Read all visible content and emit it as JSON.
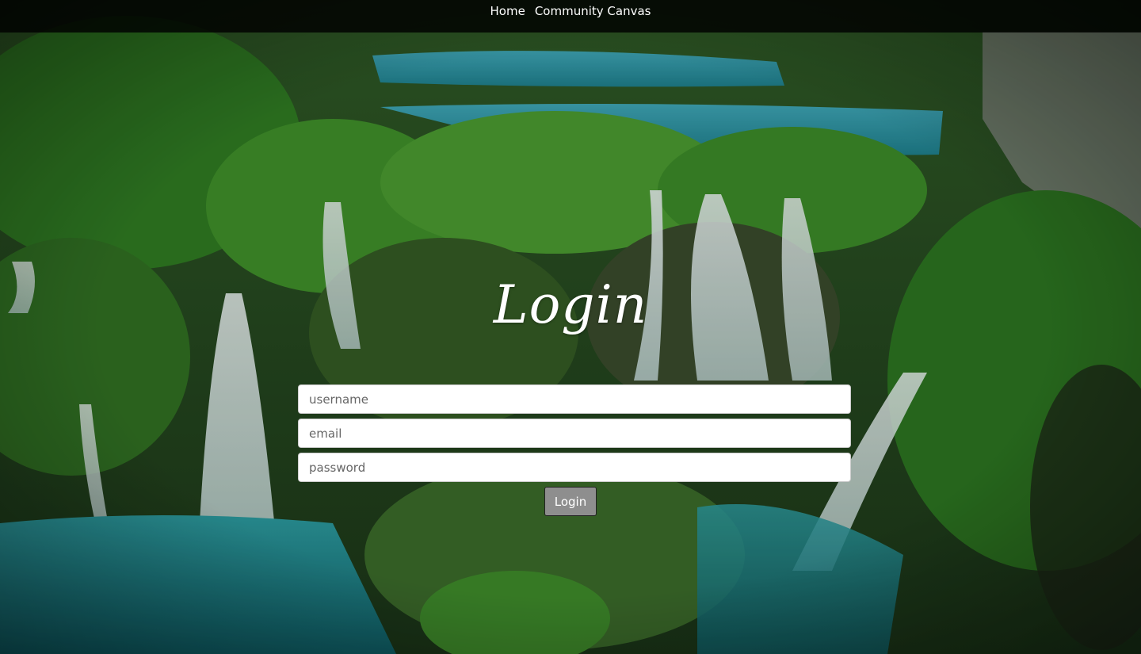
{
  "nav": {
    "home_label": "Home",
    "community_label": "Community Canvas"
  },
  "login": {
    "title": "Login",
    "username_placeholder": "username",
    "email_placeholder": "email",
    "password_placeholder": "password",
    "button_label": "Login"
  },
  "colors": {
    "navbar_bg": "#000000",
    "button_bg": "#8e8e8e",
    "field_bg": "#ffffff"
  }
}
